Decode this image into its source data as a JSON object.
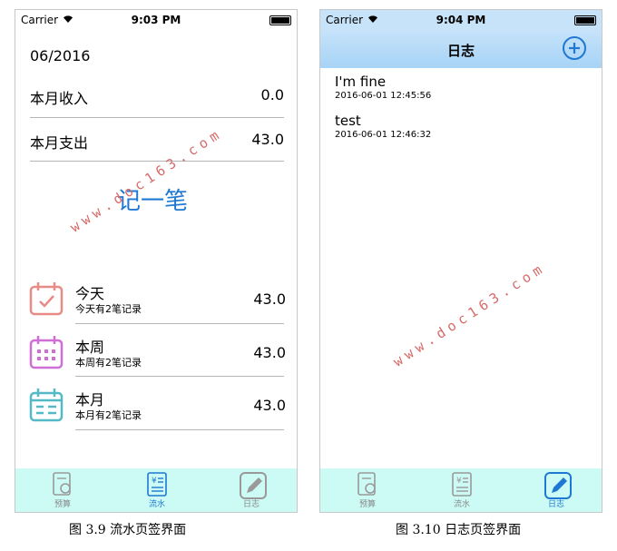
{
  "screen1": {
    "status": {
      "carrier": "Carrier",
      "time": "9:03 PM"
    },
    "month": "06/2016",
    "income": {
      "label": "本月收入",
      "value": "0.0"
    },
    "expense": {
      "label": "本月支出",
      "value": "43.0"
    },
    "record_button": "记一笔",
    "watermark": "www.doc163.com",
    "periods": [
      {
        "title": "今天",
        "subtitle": "今天有2笔记录",
        "value": "43.0",
        "icon": "calendar-check-icon",
        "color": "#e88b86"
      },
      {
        "title": "本周",
        "subtitle": "本周有2笔记录",
        "value": "43.0",
        "icon": "calendar-week-icon",
        "color": "#cf6fd6"
      },
      {
        "title": "本月",
        "subtitle": "本月有2笔记录",
        "value": "43.0",
        "icon": "calendar-month-icon",
        "color": "#54b9c6"
      }
    ],
    "tabs": [
      {
        "label": "预算",
        "icon": "budget-icon",
        "active": false
      },
      {
        "label": "流水",
        "icon": "ledger-icon",
        "active": true
      },
      {
        "label": "日志",
        "icon": "pencil-icon",
        "active": false
      }
    ],
    "caption": "图 3.9 流水页签界面"
  },
  "screen2": {
    "status": {
      "carrier": "Carrier",
      "time": "9:04 PM"
    },
    "title": "日志",
    "entries": [
      {
        "text": "I'm fine",
        "time": "2016-06-01 12:45:56"
      },
      {
        "text": "test",
        "time": "2016-06-01 12:46:32"
      }
    ],
    "watermark": "www.doc163.com",
    "tabs": [
      {
        "label": "预算",
        "icon": "budget-icon",
        "active": false
      },
      {
        "label": "流水",
        "icon": "ledger-icon",
        "active": false
      },
      {
        "label": "日志",
        "icon": "pencil-icon",
        "active": true
      }
    ],
    "caption": "图 3.10 日志页签界面"
  },
  "colors": {
    "accent": "#1f78d1",
    "tabbar": "#ccfbf6",
    "navbar": "#b3d9f7",
    "watermark": "#d76a6a"
  }
}
